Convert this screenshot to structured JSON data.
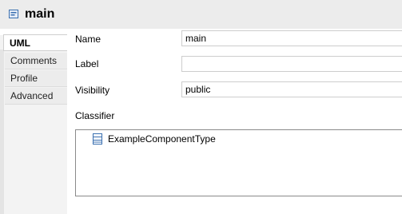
{
  "header": {
    "title": "main",
    "icon": "property-icon"
  },
  "tabs": [
    {
      "label": "UML",
      "active": true
    },
    {
      "label": "Comments",
      "active": false
    },
    {
      "label": "Profile",
      "active": false
    },
    {
      "label": "Advanced",
      "active": false
    }
  ],
  "form": {
    "name_label": "Name",
    "name_value": "main",
    "label_label": "Label",
    "label_value": "",
    "visibility_label": "Visibility",
    "visibility_value": "public",
    "classifier_label": "Classifier",
    "classifier_items": [
      {
        "label": "ExampleComponentType",
        "icon": "component-type-icon"
      }
    ]
  },
  "colors": {
    "header_bg": "#ececec",
    "icon_blue": "#3a6fb0"
  }
}
